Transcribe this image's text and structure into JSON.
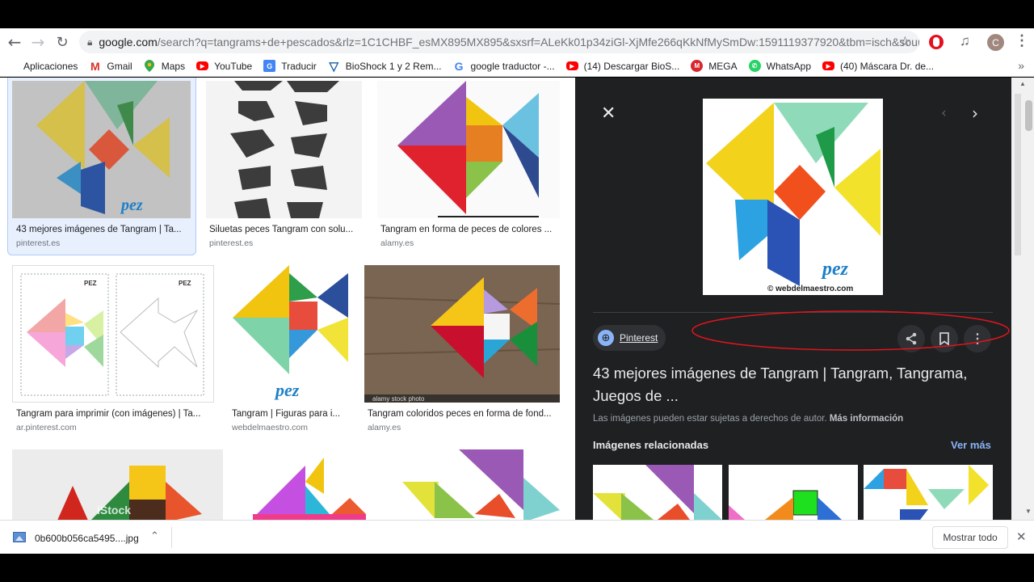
{
  "browser": {
    "url_host": "google.com",
    "url_path": "/search?q=tangrams+de+pescados&rlz=1C1CHBF_esMX895MX895&sxsrf=ALeKk01p34ziGl-XjMfe266qKkNfMySmDw:1591119377920&tbm=isch&sourc...",
    "profile_initial": "C"
  },
  "bookmarks": [
    {
      "label": "Aplicaciones",
      "icon": "apps-icon"
    },
    {
      "label": "Gmail",
      "icon": "gmail-icon"
    },
    {
      "label": "Maps",
      "icon": "maps-icon"
    },
    {
      "label": "YouTube",
      "icon": "youtube-icon"
    },
    {
      "label": "Traducir",
      "icon": "translate-icon"
    },
    {
      "label": "BioShock 1 y 2 Rem...",
      "icon": "bioshock-icon"
    },
    {
      "label": "google traductor -...",
      "icon": "google-icon"
    },
    {
      "label": "(14) Descargar BioS...",
      "icon": "youtube-icon"
    },
    {
      "label": "MEGA",
      "icon": "mega-icon"
    },
    {
      "label": "WhatsApp",
      "icon": "whatsapp-icon"
    },
    {
      "label": "(40) Máscara Dr. de...",
      "icon": "youtube-icon"
    }
  ],
  "results": [
    {
      "caption": "43 mejores imágenes de Tangram | Ta...",
      "source": "pinterest.es"
    },
    {
      "caption": "Siluetas peces Tangram con solu...",
      "source": "pinterest.es"
    },
    {
      "caption": "Tangram en forma de peces de colores ...",
      "source": "alamy.es"
    },
    {
      "caption": "Tangram para imprimir (con imágenes) | Ta...",
      "source": "ar.pinterest.com"
    },
    {
      "caption": "Tangram | Figuras para i...",
      "source": "webdelmaestro.com"
    },
    {
      "caption": "Tangram coloridos peces en forma de fond...",
      "source": "alamy.es"
    }
  ],
  "thumb_text": {
    "pez": "pez",
    "pez_label": "PEZ",
    "alamy_watermark": "alamy stock photo",
    "istock": "iStock",
    "site_credit": "© webdelmaestro.com"
  },
  "panel": {
    "source_chip": "Pinterest",
    "title": "43 mejores imágenes de Tangram | Tangram, Tangrama, Juegos de ...",
    "disclaimer": "Las imágenes pueden estar sujetas a derechos de autor.",
    "more_info": "Más información",
    "related_heading": "Imágenes relacionadas",
    "see_more": "Ver más"
  },
  "download": {
    "filename": "0b600b056ca5495....jpg",
    "show_all": "Mostrar todo"
  },
  "colors": {
    "annotation_red": "#e0141e",
    "panel_bg": "#1f2021",
    "link_blue": "#8ab4f8"
  }
}
